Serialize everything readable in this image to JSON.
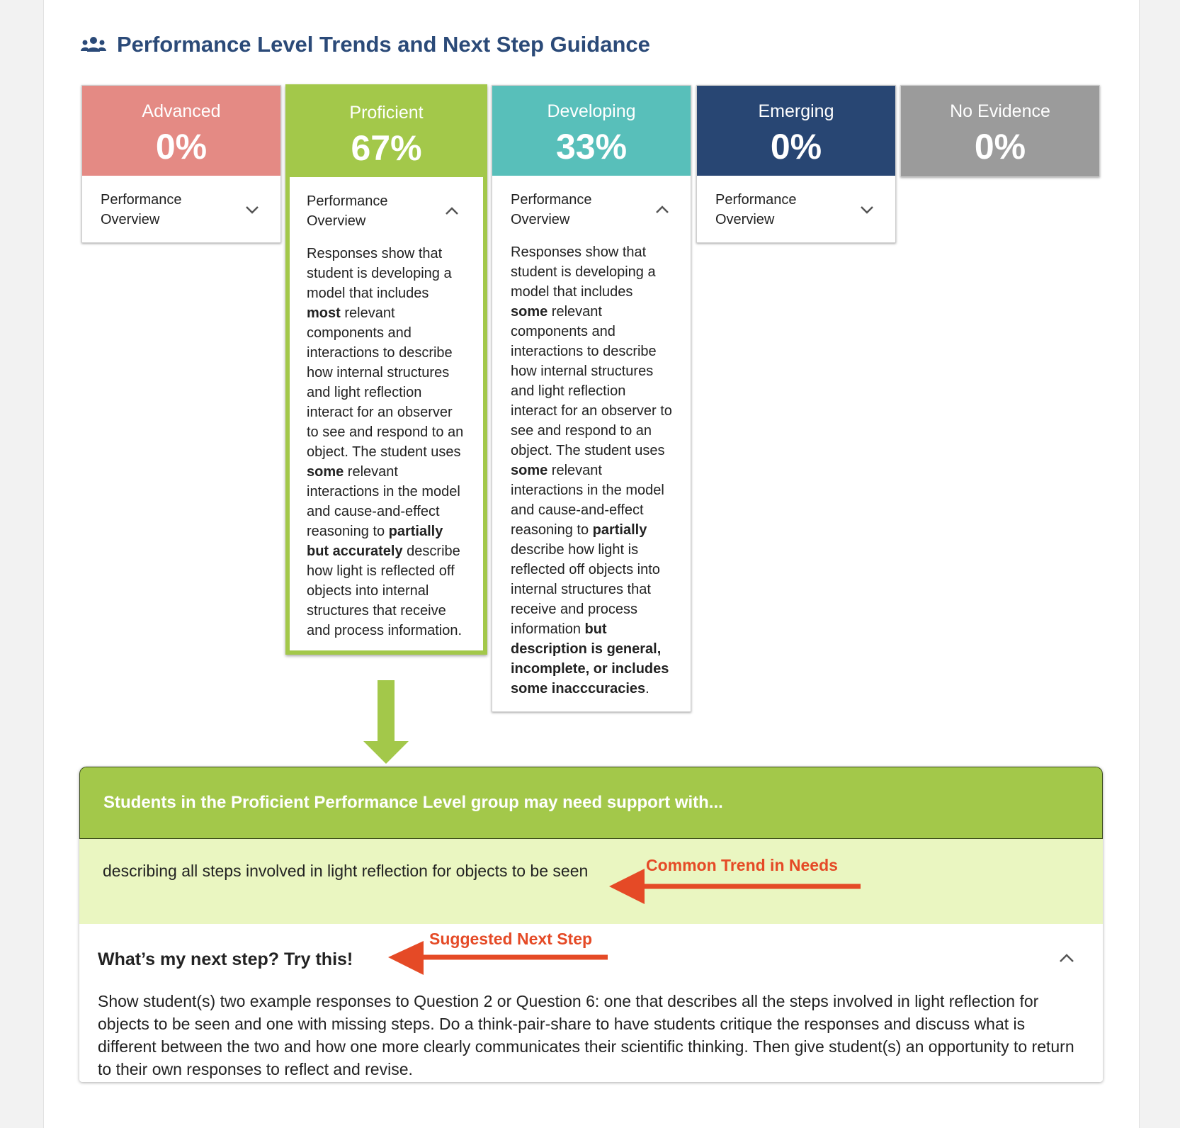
{
  "header": {
    "icon": "people-group-icon",
    "title": "Performance Level Trends and Next Step Guidance"
  },
  "levels": [
    {
      "name": "Advanced",
      "percent": "0%",
      "color": "#e48a84",
      "overview_label": "Performance Overview",
      "expanded": false
    },
    {
      "name": "Proficient",
      "percent": "67%",
      "color": "#a3c84a",
      "overview_label": "Performance Overview",
      "expanded": true,
      "description_parts": [
        {
          "text": "Responses show that student is developing a model that includes ",
          "bold": false
        },
        {
          "text": "most",
          "bold": true
        },
        {
          "text": " relevant components and interactions to describe how internal structures and light reflection interact for an observer to see and respond to an object. The student uses ",
          "bold": false
        },
        {
          "text": "some",
          "bold": true
        },
        {
          "text": " relevant interactions in the model and cause-and-effect reasoning to ",
          "bold": false
        },
        {
          "text": "partially but accurately",
          "bold": true
        },
        {
          "text": " describe how light is reflected off objects into internal structures that receive and process information.",
          "bold": false
        }
      ]
    },
    {
      "name": "Developing",
      "percent": "33%",
      "color": "#58bfba",
      "overview_label": "Performance Overview",
      "expanded": true,
      "description_parts": [
        {
          "text": "Responses show that student is developing a model that includes ",
          "bold": false
        },
        {
          "text": "some",
          "bold": true
        },
        {
          "text": " relevant components and interactions to describe how internal structures and light reflection interact for an observer to see and respond to an object. The student uses ",
          "bold": false
        },
        {
          "text": "some",
          "bold": true
        },
        {
          "text": " relevant interactions in the model and cause-and-effect reasoning to ",
          "bold": false
        },
        {
          "text": "partially",
          "bold": true
        },
        {
          "text": " describe how light is reflected off objects into internal structures that receive and process information ",
          "bold": false
        },
        {
          "text": "but description is general, incomplete, or includes some inacccuracies",
          "bold": true
        },
        {
          "text": ".",
          "bold": false
        }
      ]
    },
    {
      "name": "Emerging",
      "percent": "0%",
      "color": "#284673",
      "overview_label": "Performance Overview",
      "expanded": false
    },
    {
      "name": "No Evidence",
      "percent": "0%",
      "color": "#9b9b9b"
    }
  ],
  "guidance": {
    "heading": "Students in the Proficient Performance Level group may need support with...",
    "trend": "describing all steps involved in light reflection for objects to be seen",
    "next_step_question": "What’s my next step? Try this!",
    "next_step_body": "Show student(s) two example responses to Question 2 or Question 6: one that describes all the steps involved in light reflection for objects to be seen and one with missing steps. Do a think-pair-share to have students critique the responses and discuss what is different between the two and how one more clearly communicates their scientific thinking. Then give student(s) an opportunity to return to their own responses to reflect and revise."
  },
  "annotations": {
    "trend_label": "Common Trend in Needs",
    "next_step_label": "Suggested Next Step",
    "color": "#e54a26"
  }
}
